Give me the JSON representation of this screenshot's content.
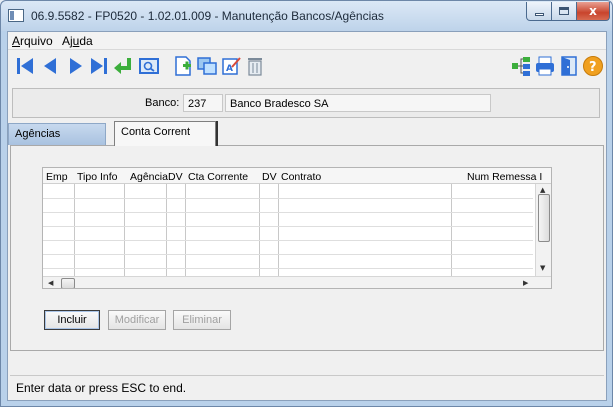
{
  "window": {
    "title": "06.9.5582 - FP0520 - 1.02.01.009 - Manutenção Bancos/Agências",
    "minimize_label": "_",
    "close_label": "x"
  },
  "menu": {
    "items": [
      {
        "label": "Arquivo",
        "accel": "A",
        "rest": "rquivo"
      },
      {
        "label": "Ajuda",
        "pre": "Aj",
        "accel": "u",
        "rest": "da"
      }
    ]
  },
  "toolbar": {
    "left_icons": [
      "first-record-icon",
      "previous-record-icon",
      "next-record-icon",
      "last-record-icon",
      "return-icon",
      "search-icon",
      "new-record-icon",
      "copy-icon",
      "edit-icon",
      "delete-icon"
    ],
    "right_icons": [
      "tree-icon",
      "print-icon",
      "exit-door-icon",
      "help-icon"
    ],
    "colors": {
      "nav_blue": "#2f6fd6",
      "green": "#3cae3c",
      "help_orange": "#f0a020"
    }
  },
  "banco": {
    "label": "Banco:",
    "code": "237",
    "name": "Banco Bradesco SA"
  },
  "tabs": [
    {
      "label": "Agências",
      "active": false
    },
    {
      "label": "Conta Corrent",
      "active": true
    }
  ],
  "grid": {
    "columns": [
      "Emp",
      "Tipo Info",
      "Agência",
      "DV",
      "Cta Corrente",
      "DV",
      "Contrato",
      "Num Remessa I"
    ],
    "rows": []
  },
  "buttons": {
    "incluir": "Incluir",
    "modificar": "Modificar",
    "eliminar": "Eliminar"
  },
  "status": {
    "text": "Enter data or press ESC to end."
  }
}
